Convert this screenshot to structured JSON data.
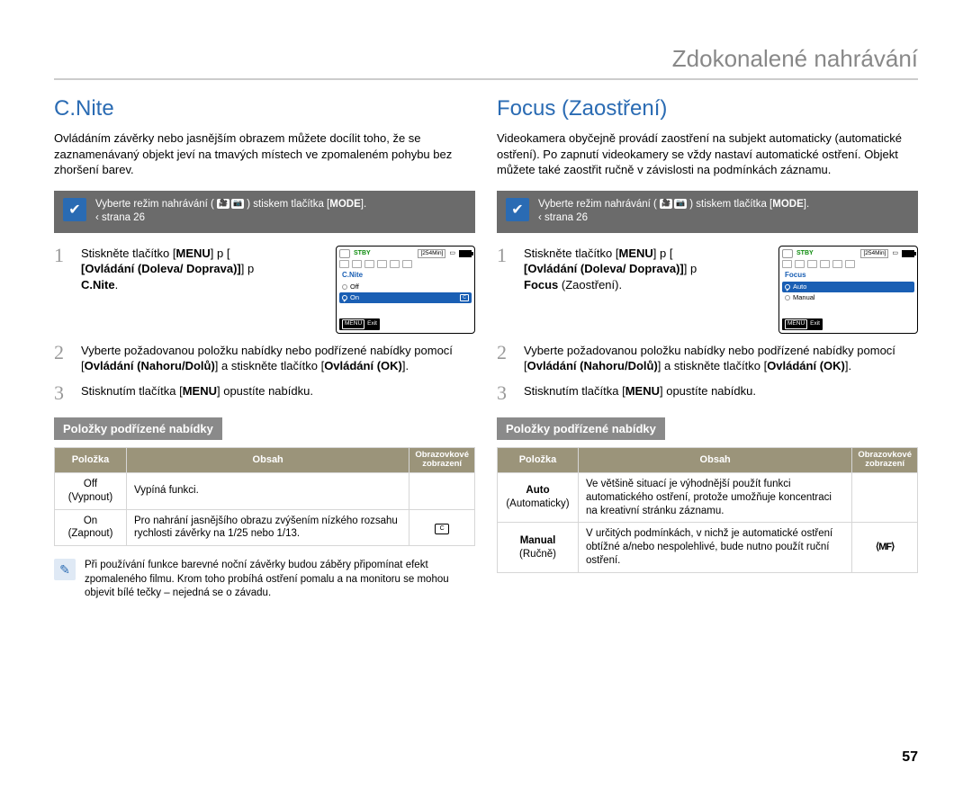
{
  "page_title": "Zdokonalené nahrávání",
  "page_number": "57",
  "mode_hint": {
    "prefix": "Vyberte režim nahrávání (",
    "suffix": ") stiskem tlačítka [",
    "btn": "MODE",
    "end": "].",
    "page_ref": "‹ strana 26"
  },
  "left": {
    "heading": "C.Nite",
    "intro": "Ovládáním závěrky nebo jasnějším obrazem můžete docílit toho, že se zaznamenávaný objekt jeví na tmavých místech ve zpomaleném pohybu bez zhoršení barev.",
    "steps": [
      {
        "pre": "Stiskněte tlačítko [",
        "b1": "MENU",
        "mid1": "] p [",
        "b2": "Ovládání (Doleva/ Doprava)",
        "mid2": "] p ",
        "b3": "C.Nite",
        "end": "."
      },
      {
        "pre": "Vyberte požadovanou položku nabídky nebo podřízené nabídky pomocí [",
        "b1": "Ovládání (Nahoru/Dolů)",
        "mid1": "] a stiskněte tlačítko [",
        "b2": "Ovládání (OK)",
        "end": "]."
      },
      {
        "pre": "Stisknutím tlačítka [",
        "b1": "MENU",
        "end": "] opustíte nabídku."
      }
    ],
    "screen": {
      "stby": "STBY",
      "time": "[254Min]",
      "menu_title": "C.Nite",
      "item_off": "Off",
      "item_on": "On",
      "exit_label": "Exit",
      "menu_btn": "MENU"
    },
    "sub_heading": "Položky podřízené nabídky",
    "table": {
      "th1": "Položka",
      "th2": "Obsah",
      "th3a": "Obrazovkové",
      "th3b": "zobrazení",
      "rows": [
        {
          "c1a": "Off",
          "c1b": "(Vypnout)",
          "c2": "Vypíná funkci.",
          "c3": ""
        },
        {
          "c1a": "On",
          "c1b": "(Zapnout)",
          "c2": "Pro nahrání jasnějšího obrazu zvýšením nízkého rozsahu rychlosti závěrky na 1/25 nebo 1/13.",
          "c3": "icon"
        }
      ]
    },
    "note": "Při používání funkce barevné noční závěrky budou záběry připomínat efekt zpomaleného filmu. Krom toho probíhá ostření pomalu a na monitoru se mohou objevit bílé tečky – nejedná se o závadu."
  },
  "right": {
    "heading": "Focus (Zaostření)",
    "intro": "Videokamera obyčejně provádí zaostření na subjekt automaticky (automatické ostření). Po zapnutí videokamery se vždy nastaví automatické ostření. Objekt můžete také zaostřit ručně v závislosti na podmínkách záznamu.",
    "steps": [
      {
        "pre": "Stiskněte tlačítko [",
        "b1": "MENU",
        "mid1": "] p [",
        "b2": "Ovládání (Doleva/ Doprava)",
        "mid2": "] p ",
        "b3": "Focus",
        "tail": " (Zaostření).",
        "end": ""
      },
      {
        "pre": "Vyberte požadovanou položku nabídky nebo podřízené nabídky pomocí [",
        "b1": "Ovládání (Nahoru/Dolů)",
        "mid1": "] a stiskněte tlačítko [",
        "b2": "Ovládání (OK)",
        "end": "]."
      },
      {
        "pre": "Stisknutím tlačítka [",
        "b1": "MENU",
        "end": "] opustíte nabídku."
      }
    ],
    "screen": {
      "stby": "STBY",
      "time": "[254Min]",
      "menu_title": "Focus",
      "item_auto": "Auto",
      "item_manual": "Manual",
      "exit_label": "Exit",
      "menu_btn": "MENU"
    },
    "sub_heading": "Položky podřízené nabídky",
    "table": {
      "th1": "Položka",
      "th2": "Obsah",
      "th3a": "Obrazovkové",
      "th3b": "zobrazení",
      "rows": [
        {
          "c1a": "Auto",
          "c1b": "(Automaticky)",
          "c2": "Ve většině situací je výhodnější použít funkci automatického ostření, protože umožňuje koncentraci na kreativní stránku záznamu.",
          "c3": ""
        },
        {
          "c1a": "Manual",
          "c1b": "(Ručně)",
          "c2": "V určitých podmínkách, v nichž je automatické ostření obtížné a/nebo nespolehlivé, bude nutno použít ruční ostření.",
          "c3": "mf"
        }
      ]
    }
  }
}
